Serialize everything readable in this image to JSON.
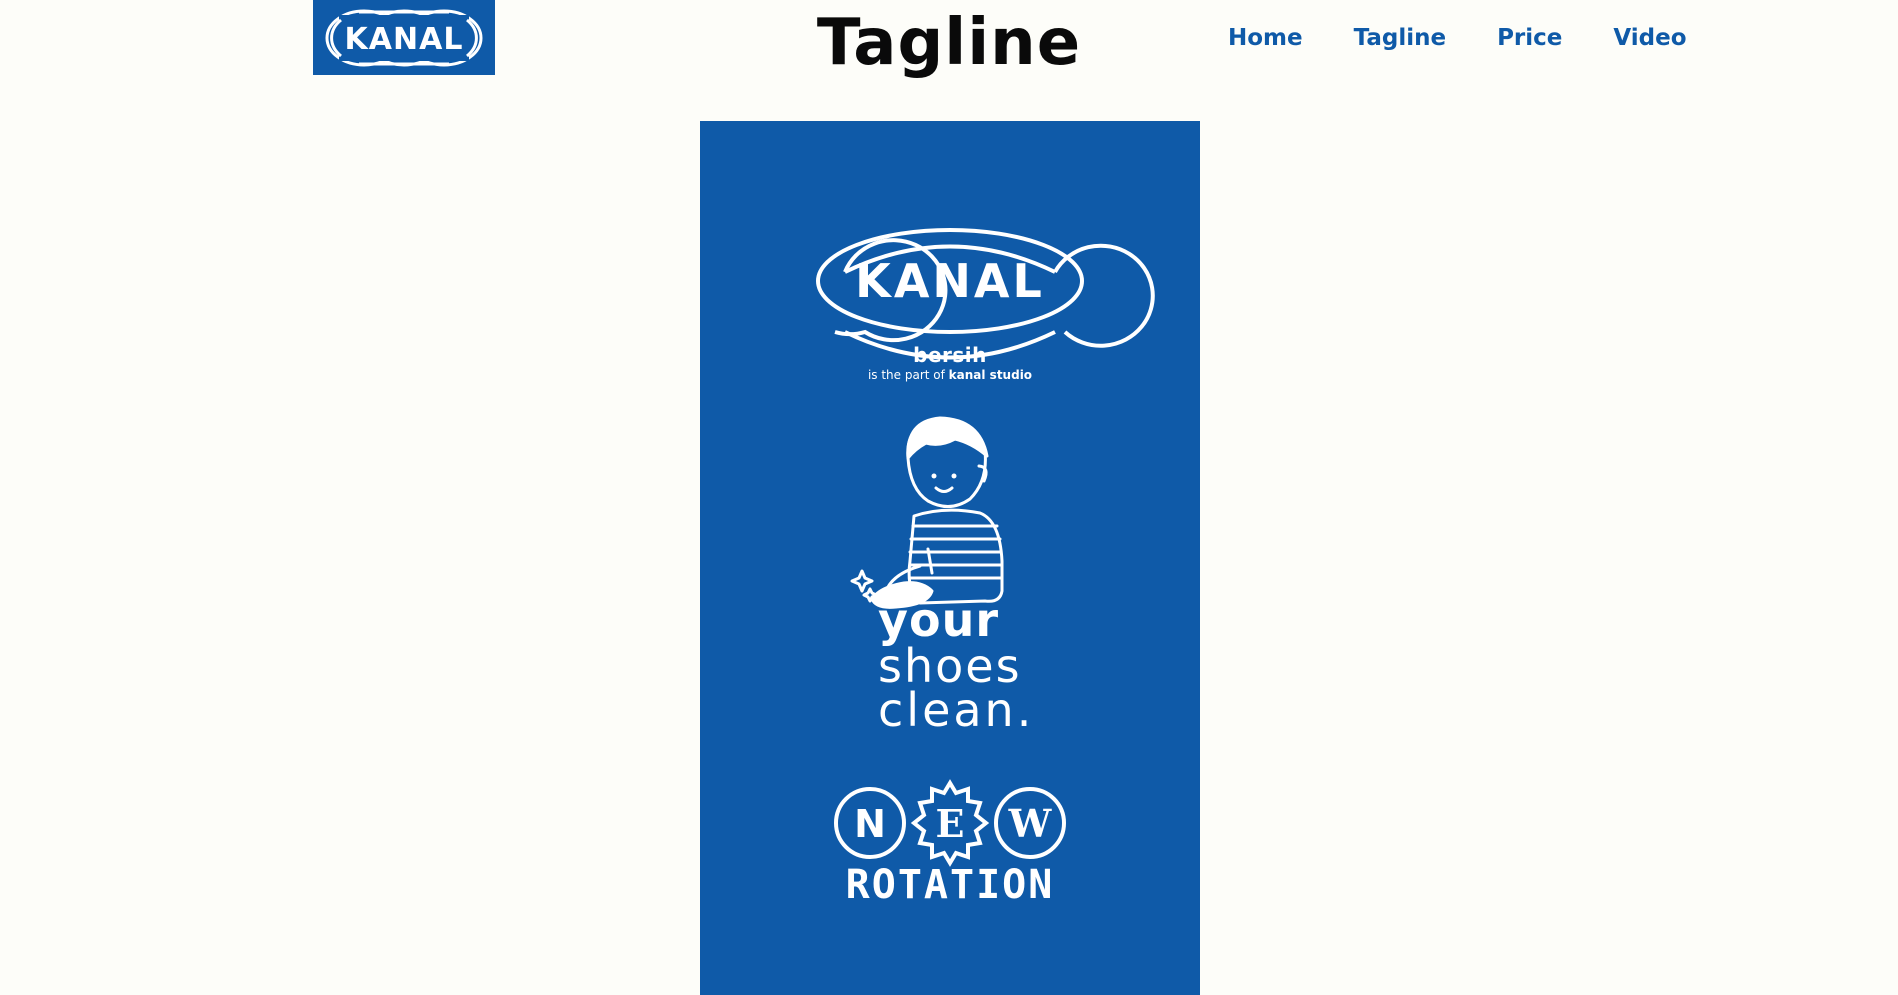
{
  "header": {
    "logo_text": "KANAL",
    "title": "Tagline",
    "nav": [
      {
        "label": "Home"
      },
      {
        "label": "Tagline"
      },
      {
        "label": "Price"
      },
      {
        "label": "Video"
      }
    ]
  },
  "poster": {
    "brand": "KANAL",
    "bersih": "bersih",
    "part_prefix": "is the part of",
    "part_brand": "kanal studio",
    "tagline_lines": [
      "your",
      "shoes",
      "clean."
    ],
    "badge_letters": [
      "N",
      "E",
      "W"
    ],
    "rotation": "ROTATION"
  },
  "colors": {
    "brand_blue": "#0f5aa8",
    "background": "#fdfdf9",
    "white": "#ffffff"
  },
  "icons": [
    "kanal-logo",
    "shoe-cleaning-boy-illustration",
    "sparkle-icon"
  ]
}
